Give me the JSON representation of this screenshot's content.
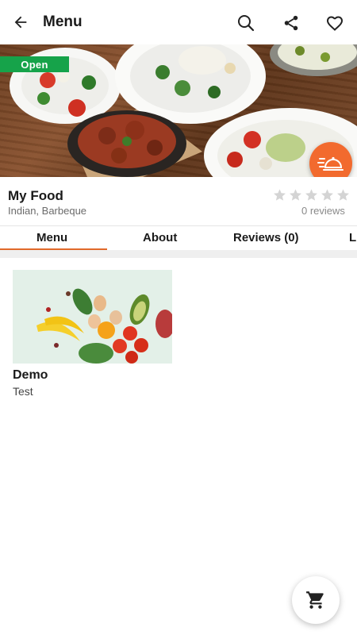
{
  "header": {
    "title": "Menu",
    "icons": [
      "back-arrow-icon",
      "search-icon",
      "share-icon",
      "heart-icon"
    ]
  },
  "hero": {
    "status_badge": "Open",
    "status_color": "#16a34a",
    "fab_color": "#f26a2e",
    "fab_icon": "delivery-cloche-icon"
  },
  "restaurant": {
    "name": "My Food",
    "cuisine": "Indian, Barbeque",
    "rating": 0,
    "rating_max": 5,
    "reviews_label": "0 reviews"
  },
  "tabs": [
    {
      "label": "Menu",
      "active": true
    },
    {
      "label": "About",
      "active": false
    },
    {
      "label": "Reviews (0)",
      "active": false
    },
    {
      "label": "L",
      "active": false
    }
  ],
  "accent_color": "#e0692a",
  "menu_items": [
    {
      "title": "Demo",
      "subtitle": "Test"
    }
  ],
  "cart": {
    "icon": "cart-icon"
  }
}
